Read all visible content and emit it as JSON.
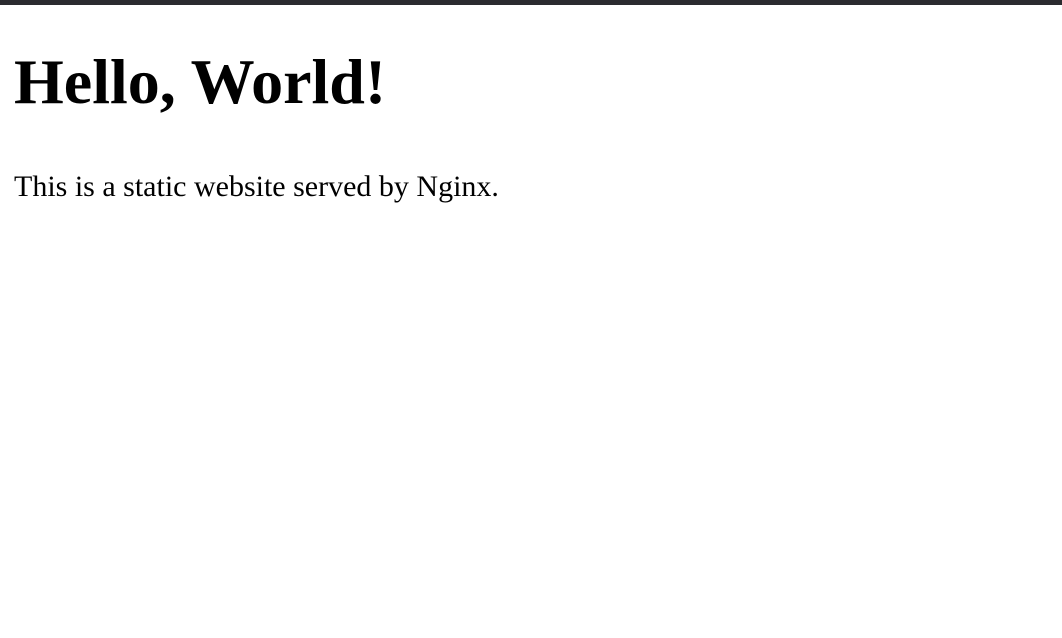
{
  "page": {
    "heading": "Hello, World!",
    "paragraph": "This is a static website served by Nginx."
  },
  "colors": {
    "background": "#ffffff",
    "text": "#000000",
    "top_border": "#2b2b2f"
  }
}
